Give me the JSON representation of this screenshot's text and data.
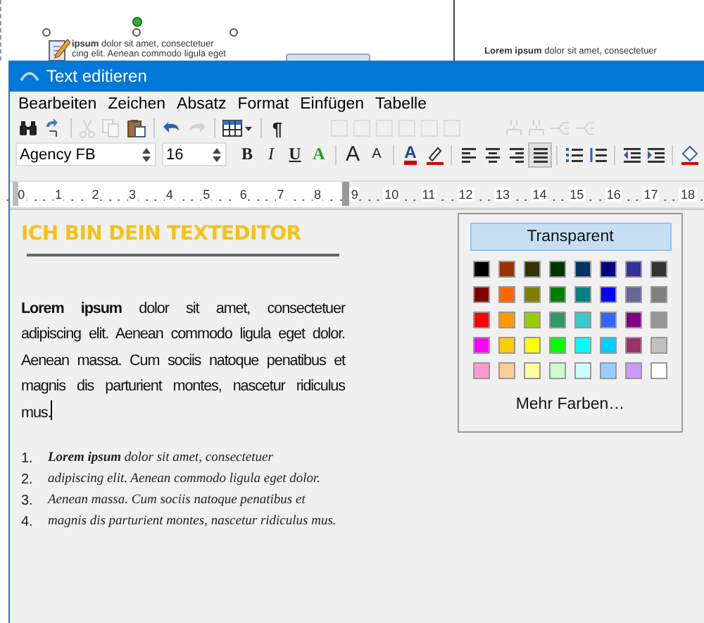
{
  "background_document": {
    "left_text": [
      "**ipsum** dolor sit amet, consectetuer",
      "cing elit. Aenean commodo ligula eget"
    ],
    "right_text": [
      "**Lorem ipsum** dolor sit amet, consectetuer"
    ]
  },
  "window": {
    "title": "Text editieren"
  },
  "menu": [
    "Bearbeiten",
    "Zeichen",
    "Absatz",
    "Format",
    "Einfügen",
    "Tabelle"
  ],
  "toolbar": [
    {
      "kind": "find",
      "disabled": false
    },
    {
      "kind": "replace",
      "disabled": false
    },
    {
      "kind": "sep"
    },
    {
      "kind": "cut",
      "disabled": true
    },
    {
      "kind": "copy",
      "disabled": true
    },
    {
      "kind": "paste",
      "disabled": false
    },
    {
      "kind": "sep"
    },
    {
      "kind": "undo",
      "disabled": false
    },
    {
      "kind": "redo",
      "disabled": true
    },
    {
      "kind": "sep"
    },
    {
      "kind": "table",
      "disabled": false
    },
    {
      "kind": "sep"
    },
    {
      "kind": "text",
      "label": "¶",
      "disabled": false
    },
    {
      "kind": "gap"
    },
    {
      "kind": "border",
      "disabled": true
    },
    {
      "kind": "border",
      "disabled": true
    },
    {
      "kind": "border",
      "disabled": true
    },
    {
      "kind": "border",
      "disabled": true
    },
    {
      "kind": "border",
      "disabled": true
    },
    {
      "kind": "border",
      "disabled": true
    },
    {
      "kind": "gap"
    },
    {
      "kind": "split",
      "disabled": true
    },
    {
      "kind": "split",
      "disabled": true
    },
    {
      "kind": "merge",
      "disabled": true
    },
    {
      "kind": "merge",
      "disabled": true
    }
  ],
  "format_bar": {
    "font": "Agency FB",
    "size": "16",
    "buttons": [
      {
        "kind": "bold",
        "label": "B"
      },
      {
        "kind": "italic",
        "label": "I"
      },
      {
        "kind": "underline",
        "label": "U"
      },
      {
        "kind": "fontstyle",
        "label": "A"
      },
      {
        "kind": "sep"
      },
      {
        "kind": "grow",
        "label": "A"
      },
      {
        "kind": "shrink",
        "label": "A"
      },
      {
        "kind": "sep"
      },
      {
        "kind": "fontcolor",
        "label": "A"
      },
      {
        "kind": "highlight"
      },
      {
        "kind": "sep"
      },
      {
        "kind": "align-left",
        "selected": false
      },
      {
        "kind": "align-center",
        "selected": false
      },
      {
        "kind": "align-right",
        "selected": false
      },
      {
        "kind": "align-justify",
        "selected": true
      },
      {
        "kind": "sep"
      },
      {
        "kind": "bullets"
      },
      {
        "kind": "numbering"
      },
      {
        "kind": "sep"
      },
      {
        "kind": "outdent"
      },
      {
        "kind": "indent"
      },
      {
        "kind": "sep"
      },
      {
        "kind": "fill"
      }
    ]
  },
  "ruler": {
    "numbers": [
      "0",
      "1",
      "2",
      "3",
      "4",
      "5",
      "6",
      "7",
      "8",
      "9",
      "10",
      "11",
      "12",
      "13",
      "14",
      "15",
      "16",
      "17",
      "18"
    ]
  },
  "document": {
    "heading": "ICH BIN DEIN TEXTEDITOR",
    "paragraph": "**Lorem ipsum** dolor sit amet, consectetuer adipiscing elit. Aenean commodo ligula eget dolor. Aenean massa. Cum sociis natoque penatibus et magnis dis parturient montes, nascetur ridiculus mus.",
    "list": [
      {
        "number": "1.",
        "text": "**Lorem ipsum** dolor sit amet, consectetuer"
      },
      {
        "number": "2.",
        "text": "adipiscing elit. Aenean commodo ligula eget dolor."
      },
      {
        "number": "3.",
        "text": "Aenean massa. Cum sociis natoque penatibus et"
      },
      {
        "number": "4.",
        "text": "magnis dis parturient montes, nascetur ridiculus mus."
      }
    ]
  },
  "color_popup": {
    "transparent_button": "Transparent",
    "colors": [
      {
        "color": "#000000"
      },
      {
        "color": "#993300"
      },
      {
        "color": "#333300"
      },
      {
        "color": "#003300"
      },
      {
        "color": "#003366"
      },
      {
        "color": "#000080"
      },
      {
        "color": "#333399"
      },
      {
        "color": "#333333"
      },
      {
        "color": "#800000"
      },
      {
        "color": "#ff6600"
      },
      {
        "color": "#808000"
      },
      {
        "color": "#008000"
      },
      {
        "color": "#008080"
      },
      {
        "color": "#0000ff"
      },
      {
        "color": "#666699"
      },
      {
        "color": "#808080"
      },
      {
        "color": "#ff0000"
      },
      {
        "color": "#ff9900"
      },
      {
        "color": "#99cc00"
      },
      {
        "color": "#339966"
      },
      {
        "color": "#33cccc"
      },
      {
        "color": "#3366ff"
      },
      {
        "color": "#800080"
      },
      {
        "color": "#969696"
      },
      {
        "color": "#ff00ff"
      },
      {
        "color": "#ffcc00"
      },
      {
        "color": "#ffff00"
      },
      {
        "color": "#00ff00"
      },
      {
        "color": "#00ffff"
      },
      {
        "color": "#00ccff"
      },
      {
        "color": "#993366"
      },
      {
        "color": "#c0c0c0"
      },
      {
        "color": "#ff99cc"
      },
      {
        "color": "#ffcc99"
      },
      {
        "color": "#ffff99"
      },
      {
        "color": "#ccffcc"
      },
      {
        "color": "#ccffff"
      },
      {
        "color": "#99ccff"
      },
      {
        "color": "#cc99ff"
      },
      {
        "color": "#ffffff"
      }
    ],
    "more_button": "Mehr Farben…"
  }
}
